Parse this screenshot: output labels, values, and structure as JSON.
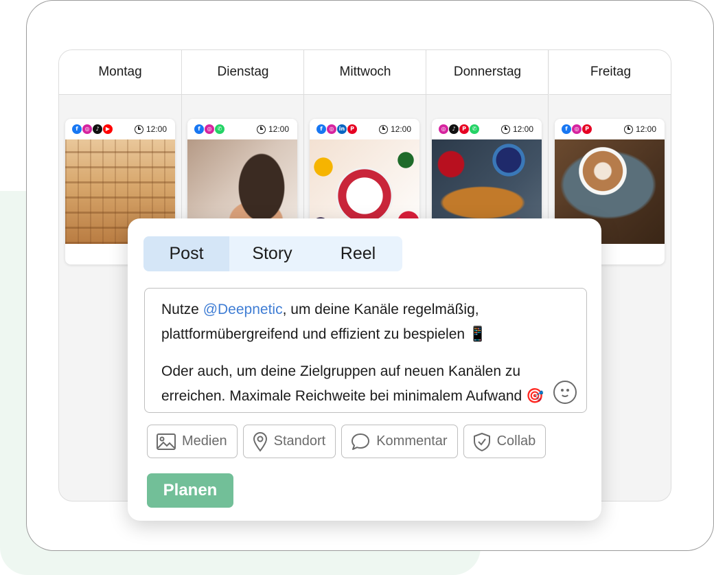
{
  "calendar": {
    "days": [
      "Montag",
      "Dienstag",
      "Mittwoch",
      "Donnerstag",
      "Freitag"
    ],
    "posts": [
      {
        "networks": [
          "facebook",
          "instagram",
          "tiktok",
          "youtube"
        ],
        "time": "12:00",
        "image": "sauna"
      },
      {
        "networks": [
          "facebook",
          "instagram",
          "whatsapp"
        ],
        "time": "12:00",
        "image": "bread"
      },
      {
        "networks": [
          "facebook",
          "instagram",
          "linkedin",
          "pinterest"
        ],
        "time": "12:00",
        "image": "fruit-bowl"
      },
      {
        "networks": [
          "instagram",
          "tiktok",
          "pinterest",
          "whatsapp"
        ],
        "time": "12:00",
        "image": "croissant-breakfast"
      },
      {
        "networks": [
          "facebook",
          "instagram",
          "pinterest"
        ],
        "time": "12:00",
        "image": "latte"
      }
    ]
  },
  "composer": {
    "tabs": [
      "Post",
      "Story",
      "Reel"
    ],
    "active_tab": "Post",
    "text": {
      "p1_before": "Nutze ",
      "mention": "@Deepnetic",
      "p1_after": ", um deine Kanäle regelmäßig, plattformübergreifend und effizient zu bespielen 📱",
      "p2": "Oder auch, um deine Zielgruppen auf neuen Kanälen zu erreichen. Maximale Reichweite bei minimalem Aufwand 🎯"
    },
    "emoji_icon": "smiley-icon",
    "actions": [
      {
        "label": "Medien",
        "icon": "image-icon"
      },
      {
        "label": "Standort",
        "icon": "location-pin-icon"
      },
      {
        "label": "Kommentar",
        "icon": "speech-bubble-icon"
      },
      {
        "label": "Collab",
        "icon": "shield-check-icon"
      }
    ],
    "submit_label": "Planen"
  },
  "colors": {
    "accent_green": "#72bf98",
    "mention_blue": "#3f7dd4",
    "tab_active": "#d5e6f7",
    "tab_bg": "#e9f3fd"
  }
}
